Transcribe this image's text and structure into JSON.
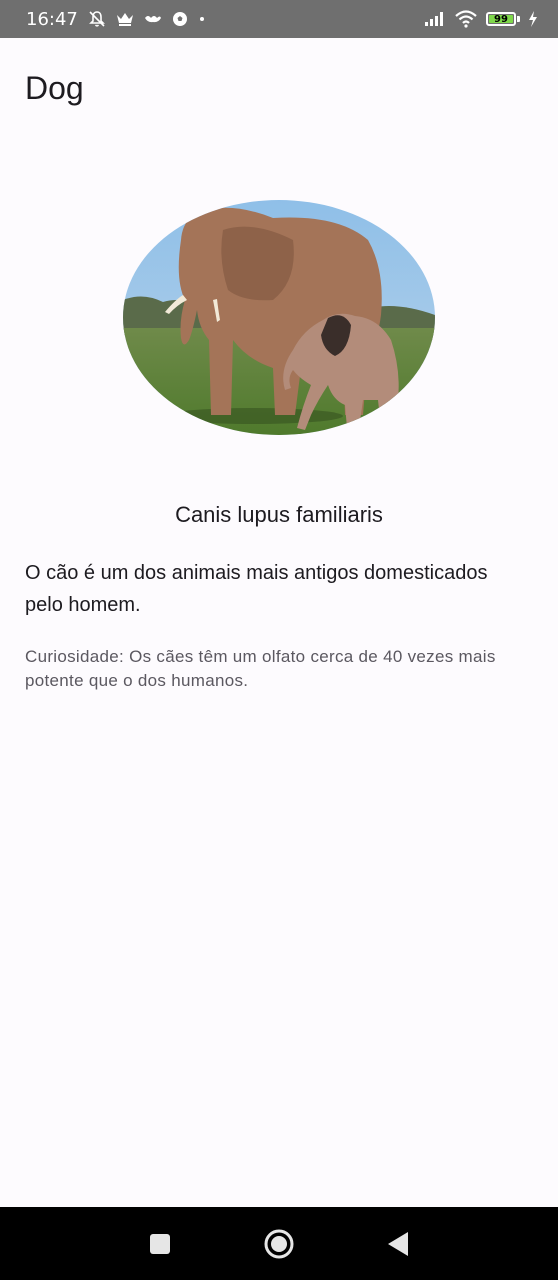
{
  "status_bar": {
    "time": "16:47",
    "battery_level": "99",
    "battery_fill_percent": 99,
    "icons_left": [
      "notifications-off-icon",
      "crown-icon",
      "app-logo-icon",
      "soccer-ball-icon",
      "dot-icon"
    ],
    "icons_right": [
      "signal-icon",
      "wifi-icon",
      "battery-icon",
      "charging-icon"
    ]
  },
  "screen": {
    "title": "Dog",
    "image_icon": "elephant-photo",
    "scientific_name": "Canis lupus familiaris",
    "description": "O cão é um dos animais mais antigos domesticados pelo homem.",
    "curiosity": "Curiosidade: Os cães têm um olfato cerca de 40 vezes mais potente que o dos humanos."
  },
  "nav_bar": {
    "icons": [
      "recents-square-icon",
      "home-circle-icon",
      "back-triangle-icon"
    ]
  },
  "colors": {
    "status_bar_bg": "#6f6f6f",
    "page_bg": "#fdfbfe",
    "text_primary": "#1d1b20",
    "text_secondary": "#5b5860",
    "nav_bar_bg": "#000000",
    "battery_fill": "#7fd84b"
  }
}
